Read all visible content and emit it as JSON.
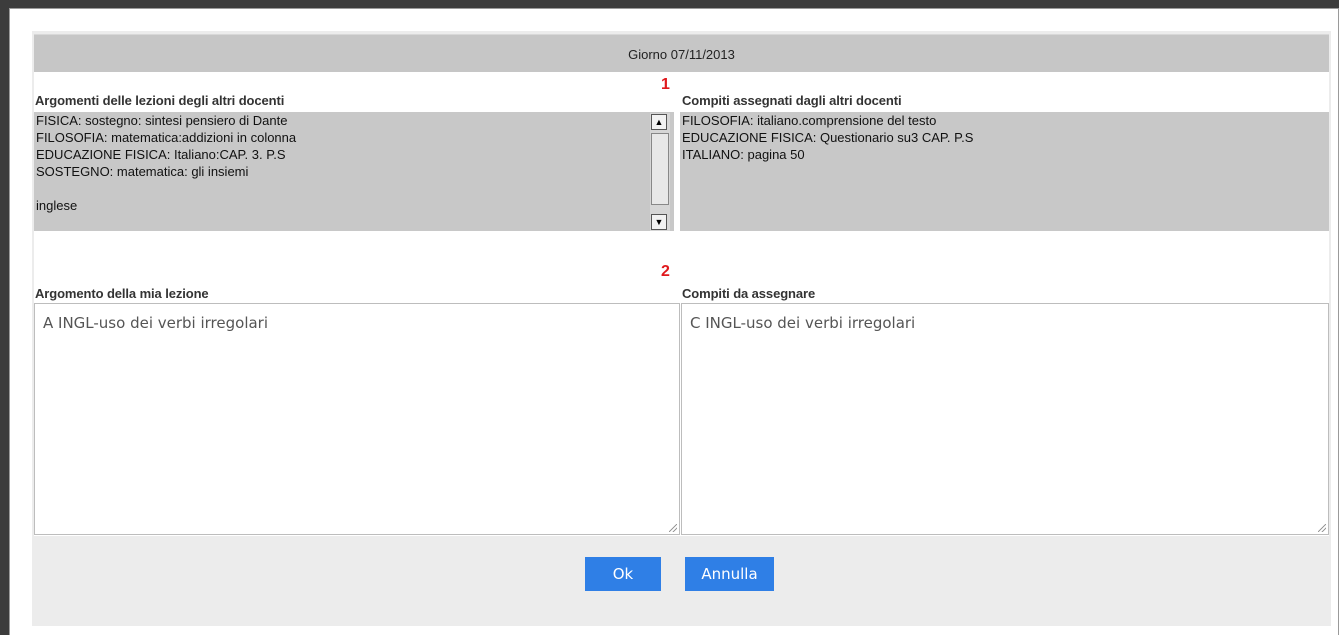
{
  "dialog": {
    "title": "Giorno 07/11/2013",
    "marker_1": "1",
    "marker_2": "2"
  },
  "other_lessons": {
    "label": "Argomenti delle lezioni degli altri docenti",
    "items": [
      "FISICA: sostegno: sintesi pensiero di Dante",
      "FILOSOFIA: matematica:addizioni in colonna",
      "EDUCAZIONE FISICA: Italiano:CAP. 3. P.S",
      "SOSTEGNO: matematica: gli insiemi",
      "",
      "inglese"
    ]
  },
  "other_homework": {
    "label": "Compiti assegnati dagli altri docenti",
    "items": [
      "FILOSOFIA: italiano.comprensione del testo",
      "EDUCAZIONE FISICA: Questionario su3 CAP. P.S",
      "ITALIANO: pagina 50"
    ]
  },
  "my_lesson": {
    "label": "Argomento della mia lezione",
    "value": "A INGL-uso dei verbi irregolari"
  },
  "homework": {
    "label": "Compiti da assegnare",
    "value": "C INGL-uso dei verbi irregolari"
  },
  "buttons": {
    "ok": "Ok",
    "cancel": "Annulla"
  },
  "colors": {
    "button": "#2f7fe6",
    "marker": "#e0191d",
    "list_bg": "#c8c8c8"
  }
}
